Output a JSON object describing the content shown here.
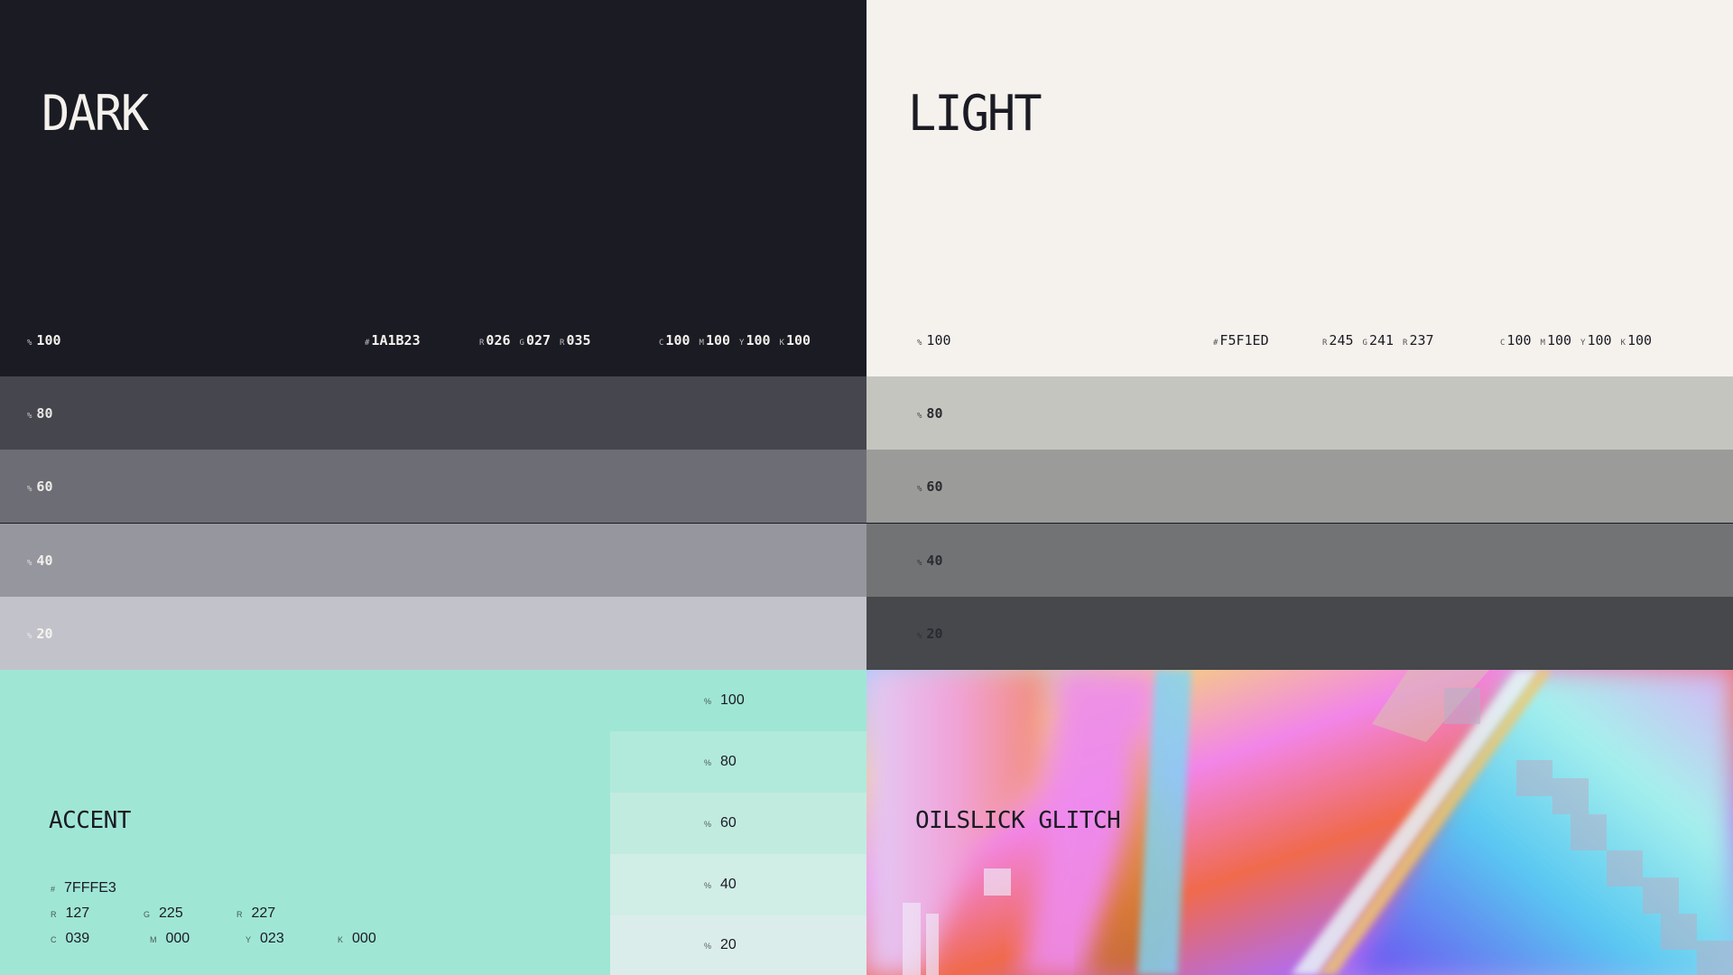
{
  "dark": {
    "title": "DARK",
    "percent_label": "%",
    "base_percent": "100",
    "hex_label": "#",
    "hex": "1A1B23",
    "rgb": [
      {
        "label": "R",
        "value": "026"
      },
      {
        "label": "G",
        "value": "027"
      },
      {
        "label": "R",
        "value": "035"
      }
    ],
    "cmyk": [
      {
        "label": "C",
        "value": "100"
      },
      {
        "label": "M",
        "value": "100"
      },
      {
        "label": "Y",
        "value": "100"
      },
      {
        "label": "K",
        "value": "100"
      }
    ],
    "tints": [
      "80",
      "60",
      "40",
      "20"
    ],
    "colors": {
      "base": "#1A1B23",
      "t80": "#45464E",
      "t60": "#6D6E75",
      "t40": "#96979E",
      "t20": "#C2C3CA"
    }
  },
  "light": {
    "title": "LIGHT",
    "percent_label": "%",
    "base_percent": "100",
    "hex_label": "#",
    "hex": "F5F1ED",
    "rgb": [
      {
        "label": "R",
        "value": "245"
      },
      {
        "label": "G",
        "value": "241"
      },
      {
        "label": "R",
        "value": "237"
      }
    ],
    "cmyk": [
      {
        "label": "C",
        "value": "100"
      },
      {
        "label": "M",
        "value": "100"
      },
      {
        "label": "Y",
        "value": "100"
      },
      {
        "label": "K",
        "value": "100"
      }
    ],
    "tints": [
      "80",
      "60",
      "40",
      "20"
    ],
    "colors": {
      "base": "#F5F1ED",
      "t80": "#C5C5C0",
      "t60": "#9B9C99",
      "t40": "#727375",
      "t20": "#46484B"
    }
  },
  "accent": {
    "title": "ACCENT",
    "percent_label": "%",
    "hex_label": "#",
    "hex": "7FFFE3",
    "rgb": [
      {
        "label": "R",
        "value": "127"
      },
      {
        "label": "G",
        "value": "225"
      },
      {
        "label": "R",
        "value": "227"
      }
    ],
    "cmyk": [
      {
        "label": "C",
        "value": "039"
      },
      {
        "label": "M",
        "value": "000"
      },
      {
        "label": "Y",
        "value": "023"
      },
      {
        "label": "K",
        "value": "000"
      }
    ],
    "tints": [
      "100",
      "80",
      "60",
      "40",
      "20"
    ],
    "colors": {
      "base": "#A0E6D5"
    }
  },
  "glitch": {
    "title": "OILSLICK GLITCH"
  }
}
